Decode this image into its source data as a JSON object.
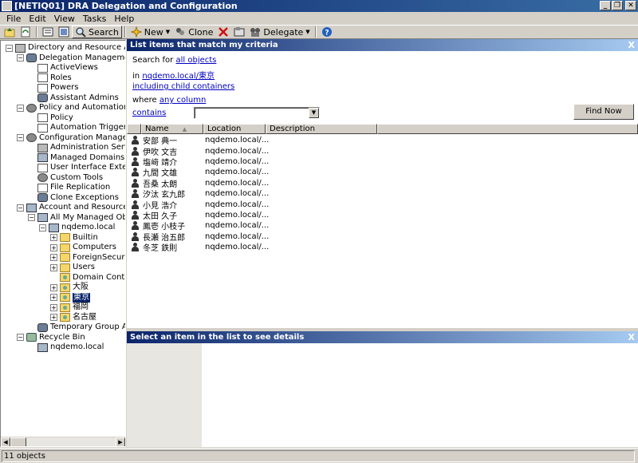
{
  "window": {
    "title": "[NETIQ01] DRA Delegation and Configuration",
    "minimize": "_",
    "restore": "❐",
    "close": "✕"
  },
  "menu": [
    "File",
    "Edit",
    "View",
    "Tasks",
    "Help"
  ],
  "toolbar": {
    "search": "Search",
    "new": "New",
    "clone": "Clone",
    "delegate": "Delegate"
  },
  "tree": [
    {
      "label": "Directory and Resource Admin",
      "level": 0,
      "icon": "server",
      "exp": "−"
    },
    {
      "label": "Delegation Management",
      "level": 1,
      "icon": "people",
      "exp": "−"
    },
    {
      "label": "ActiveViews",
      "level": 2,
      "icon": "doc",
      "exp": ""
    },
    {
      "label": "Roles",
      "level": 2,
      "icon": "doc",
      "exp": ""
    },
    {
      "label": "Powers",
      "level": 2,
      "icon": "doc",
      "exp": ""
    },
    {
      "label": "Assistant Admins",
      "level": 2,
      "icon": "people",
      "exp": ""
    },
    {
      "label": "Policy and Automation Ma",
      "level": 1,
      "icon": "gear",
      "exp": "−"
    },
    {
      "label": "Policy",
      "level": 2,
      "icon": "doc",
      "exp": ""
    },
    {
      "label": "Automation Triggers",
      "level": 2,
      "icon": "doc",
      "exp": ""
    },
    {
      "label": "Configuration Management",
      "level": 1,
      "icon": "gear",
      "exp": "−"
    },
    {
      "label": "Administration Servers",
      "level": 2,
      "icon": "server",
      "exp": ""
    },
    {
      "label": "Managed Domains",
      "level": 2,
      "icon": "domain",
      "exp": ""
    },
    {
      "label": "User Interface Extensi",
      "level": 2,
      "icon": "doc",
      "exp": ""
    },
    {
      "label": "Custom Tools",
      "level": 2,
      "icon": "gear",
      "exp": ""
    },
    {
      "label": "File Replication",
      "level": 2,
      "icon": "doc",
      "exp": ""
    },
    {
      "label": "Clone Exceptions",
      "level": 2,
      "icon": "people",
      "exp": ""
    },
    {
      "label": "Account and Resource Ma",
      "level": 1,
      "icon": "domain",
      "exp": "−"
    },
    {
      "label": "All My Managed Objec",
      "level": 2,
      "icon": "domain",
      "exp": "−"
    },
    {
      "label": "nqdemo.local",
      "level": 3,
      "icon": "domain",
      "exp": "−"
    },
    {
      "label": "Builtin",
      "level": 4,
      "icon": "folder",
      "exp": "+"
    },
    {
      "label": "Computers",
      "level": 4,
      "icon": "folder",
      "exp": "+"
    },
    {
      "label": "ForeignSecurity",
      "level": 4,
      "icon": "folder",
      "exp": "+"
    },
    {
      "label": "Users",
      "level": 4,
      "icon": "folder",
      "exp": "+"
    },
    {
      "label": "Domain Contro",
      "level": 4,
      "icon": "ou",
      "exp": ""
    },
    {
      "label": "大阪",
      "level": 4,
      "icon": "ou",
      "exp": "+"
    },
    {
      "label": "東京",
      "level": 4,
      "icon": "ou",
      "exp": "+",
      "selected": true
    },
    {
      "label": "福岡",
      "level": 4,
      "icon": "ou",
      "exp": "+"
    },
    {
      "label": "名古屋",
      "level": 4,
      "icon": "ou",
      "exp": "+"
    },
    {
      "label": "Temporary Group Assi",
      "level": 2,
      "icon": "people",
      "exp": ""
    },
    {
      "label": "Recycle Bin",
      "level": 1,
      "icon": "bin",
      "exp": "−"
    },
    {
      "label": "nqdemo.local",
      "level": 2,
      "icon": "domain",
      "exp": ""
    }
  ],
  "search_panel": {
    "header": "List items that match my criteria",
    "close": "X",
    "search_for_prefix": "Search for",
    "search_for_link": "all objects",
    "in_prefix": "in",
    "in_link": "nqdemo.local/東京",
    "include_link": "including child containers",
    "where_prefix": "where",
    "where_link": "any column",
    "contains_link": "contains",
    "contains_value": "",
    "find_now": "Find Now"
  },
  "columns": [
    "Name",
    "Location",
    "Description"
  ],
  "rows": [
    {
      "name": "安部 典一",
      "location": "nqdemo.local/..."
    },
    {
      "name": "伊吹 文吉",
      "location": "nqdemo.local/..."
    },
    {
      "name": "塩﨑 靖介",
      "location": "nqdemo.local/..."
    },
    {
      "name": "九間 文雄",
      "location": "nqdemo.local/..."
    },
    {
      "name": "吾桑 太朗",
      "location": "nqdemo.local/..."
    },
    {
      "name": "汐汰 玄九郎",
      "location": "nqdemo.local/..."
    },
    {
      "name": "小見 浩介",
      "location": "nqdemo.local/..."
    },
    {
      "name": "太田 久子",
      "location": "nqdemo.local/..."
    },
    {
      "name": "鳳壱 小枝子",
      "location": "nqdemo.local/..."
    },
    {
      "name": "長瀬 治五郎",
      "location": "nqdemo.local/..."
    },
    {
      "name": "冬芝 鉄則",
      "location": "nqdemo.local/..."
    }
  ],
  "details_panel": {
    "header": "Select an item in the list to see details",
    "close": "X"
  },
  "status": "11 objects"
}
